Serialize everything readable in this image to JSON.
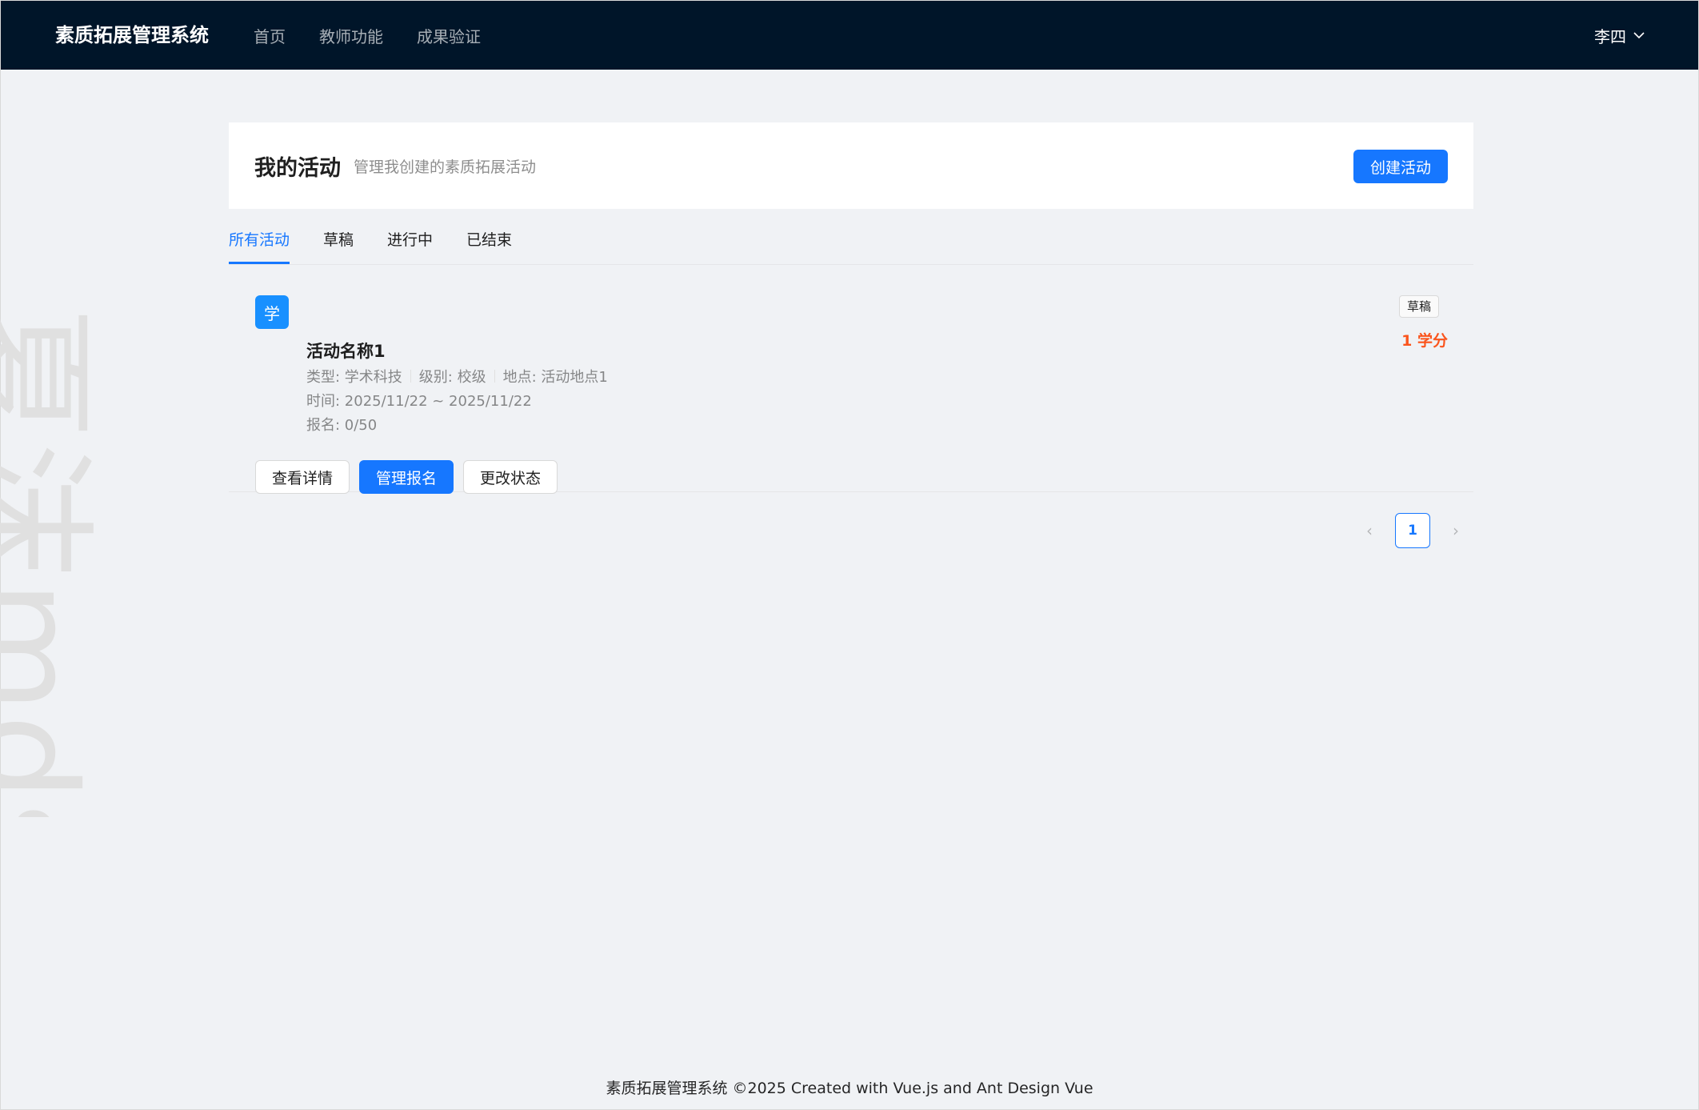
{
  "header": {
    "logo": "素质拓展管理系统",
    "nav": [
      "首页",
      "教师功能",
      "成果验证"
    ],
    "user": "李四"
  },
  "watermark": "夏沫mds",
  "page": {
    "title": "我的活动",
    "subtitle": "管理我创建的素质拓展活动",
    "create_label": "创建活动"
  },
  "tabs": [
    {
      "label": "所有活动",
      "active": true
    },
    {
      "label": "草稿",
      "active": false
    },
    {
      "label": "进行中",
      "active": false
    },
    {
      "label": "已结束",
      "active": false
    }
  ],
  "activities": [
    {
      "avatar": "学",
      "name": "活动名称1",
      "type_label": "类型: 学术科技",
      "level_label": "级别: 校级",
      "location_label": "地点: 活动地点1",
      "time_label": "时间: 2025/11/22 ~ 2025/11/22",
      "signup_label": "报名: 0/50",
      "status": "草稿",
      "credit": "1 学分",
      "actions": [
        "查看详情",
        "管理报名",
        "更改状态"
      ]
    }
  ],
  "pagination": {
    "current": "1",
    "prev": "‹",
    "next": "›"
  },
  "footer": "素质拓展管理系统 ©2025 Created with Vue.js and Ant Design Vue",
  "colors": {
    "header_bg": "#001529",
    "primary": "#1677ff",
    "credit": "#fa541c",
    "avatar": "#1890ff"
  },
  "icons": {
    "user_menu": "chevron-down-icon",
    "prev": "left-arrow-icon",
    "next": "right-arrow-icon"
  }
}
